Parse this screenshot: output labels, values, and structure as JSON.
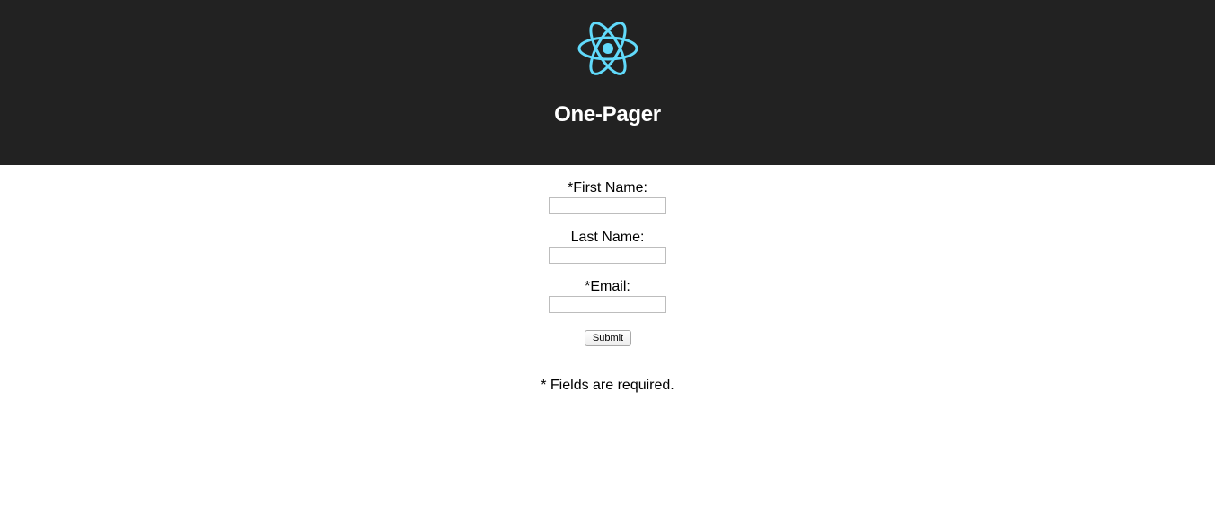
{
  "header": {
    "logo_icon": "react-atom-icon",
    "logo_color": "#61DAFB",
    "background_color": "#222222",
    "title": "One-Pager"
  },
  "form": {
    "first_name": {
      "label": "*First Name:",
      "value": ""
    },
    "last_name": {
      "label": "Last Name:",
      "value": ""
    },
    "email": {
      "label": "*Email:",
      "value": ""
    },
    "submit_label": "Submit"
  },
  "footer_note": "* Fields are required."
}
